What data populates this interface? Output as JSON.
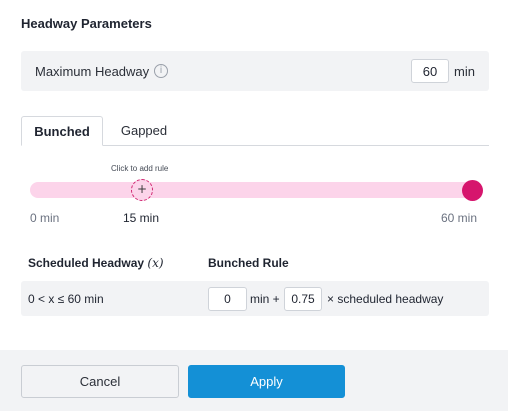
{
  "section": {
    "title": "Headway Parameters"
  },
  "maximum_headway": {
    "label": "Maximum Headway",
    "info_icon": "info-icon",
    "value": "60",
    "unit": "min"
  },
  "tabs": [
    {
      "label": "Bunched",
      "active": true
    },
    {
      "label": "Gapped",
      "active": false
    }
  ],
  "slider": {
    "hint": "Click to add rule",
    "add_symbol": "+",
    "min_label": "0 min",
    "marker_label": "15 min",
    "max_label": "60 min",
    "marker_value": 15,
    "max_value": 60,
    "track_color": "#fcd4ea",
    "handle_color": "#d6156d"
  },
  "rules_table": {
    "col1_header": "Scheduled Headway",
    "col1_var": "(x)",
    "col2_header": "Bunched Rule",
    "rows": [
      {
        "range": "0 < x ≤ 60 min",
        "min_value": "0",
        "text_min_plus": "min +",
        "multiplier": "0.75",
        "text_scheduled": "× scheduled headway"
      }
    ]
  },
  "footer": {
    "cancel_label": "Cancel",
    "apply_label": "Apply",
    "apply_color": "#1490d6"
  }
}
